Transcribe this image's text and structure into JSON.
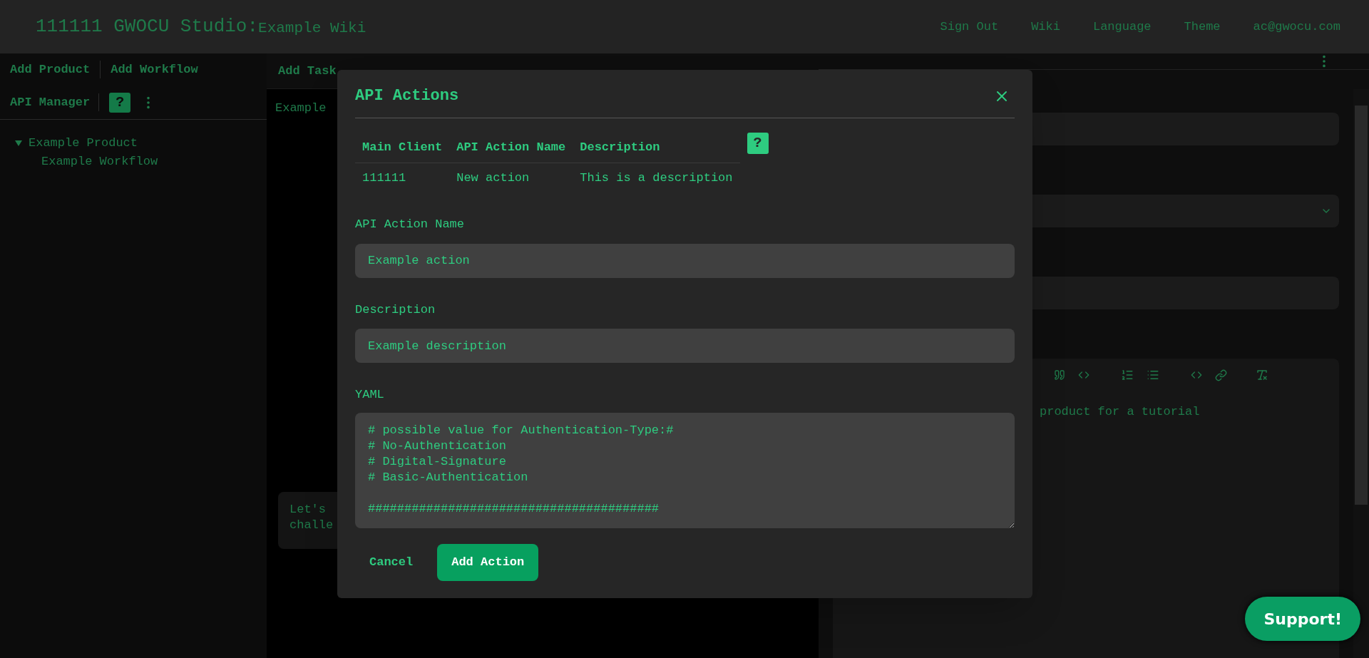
{
  "header": {
    "title": "111111 GWOCU Studio:",
    "subtitle": "Example Wiki",
    "nav": [
      "Sign Out",
      "Wiki",
      "Language",
      "Theme",
      "ac@gwocu.com"
    ]
  },
  "sidebar": {
    "toolbar": [
      "Add Product",
      "Add Workflow",
      "API Manager"
    ],
    "help": "?",
    "tree": [
      {
        "label": "Example Product",
        "expanded": true,
        "children": [
          {
            "label": "Example Workflow"
          }
        ]
      }
    ]
  },
  "middle": {
    "toolbar": [
      "Add Task"
    ],
    "content": "Example",
    "note_lines": [
      "Let's",
      "challe"
    ]
  },
  "right": {
    "editor_text": "product for a tutorial"
  },
  "modal": {
    "title": "API Actions",
    "table": {
      "columns": [
        "Main Client",
        "API Action Name",
        "Description"
      ],
      "rows": [
        [
          "111111",
          "New action",
          "This is a description"
        ]
      ]
    },
    "help": "?",
    "fields": [
      {
        "label": "API Action Name",
        "value": "Example action"
      },
      {
        "label": "Description",
        "value": "Example description"
      }
    ],
    "yaml": {
      "label": "YAML",
      "comment_lines": [
        "# possible value for Authentication-Type:#",
        "# No-Authentication",
        "# Digital-Signature",
        "# Basic-Authentication"
      ],
      "rule": "########################################"
    },
    "buttons": [
      {
        "label": "Cancel",
        "kind": "text"
      },
      {
        "label": "Add Action",
        "kind": "primary"
      }
    ]
  },
  "support": "Support!"
}
